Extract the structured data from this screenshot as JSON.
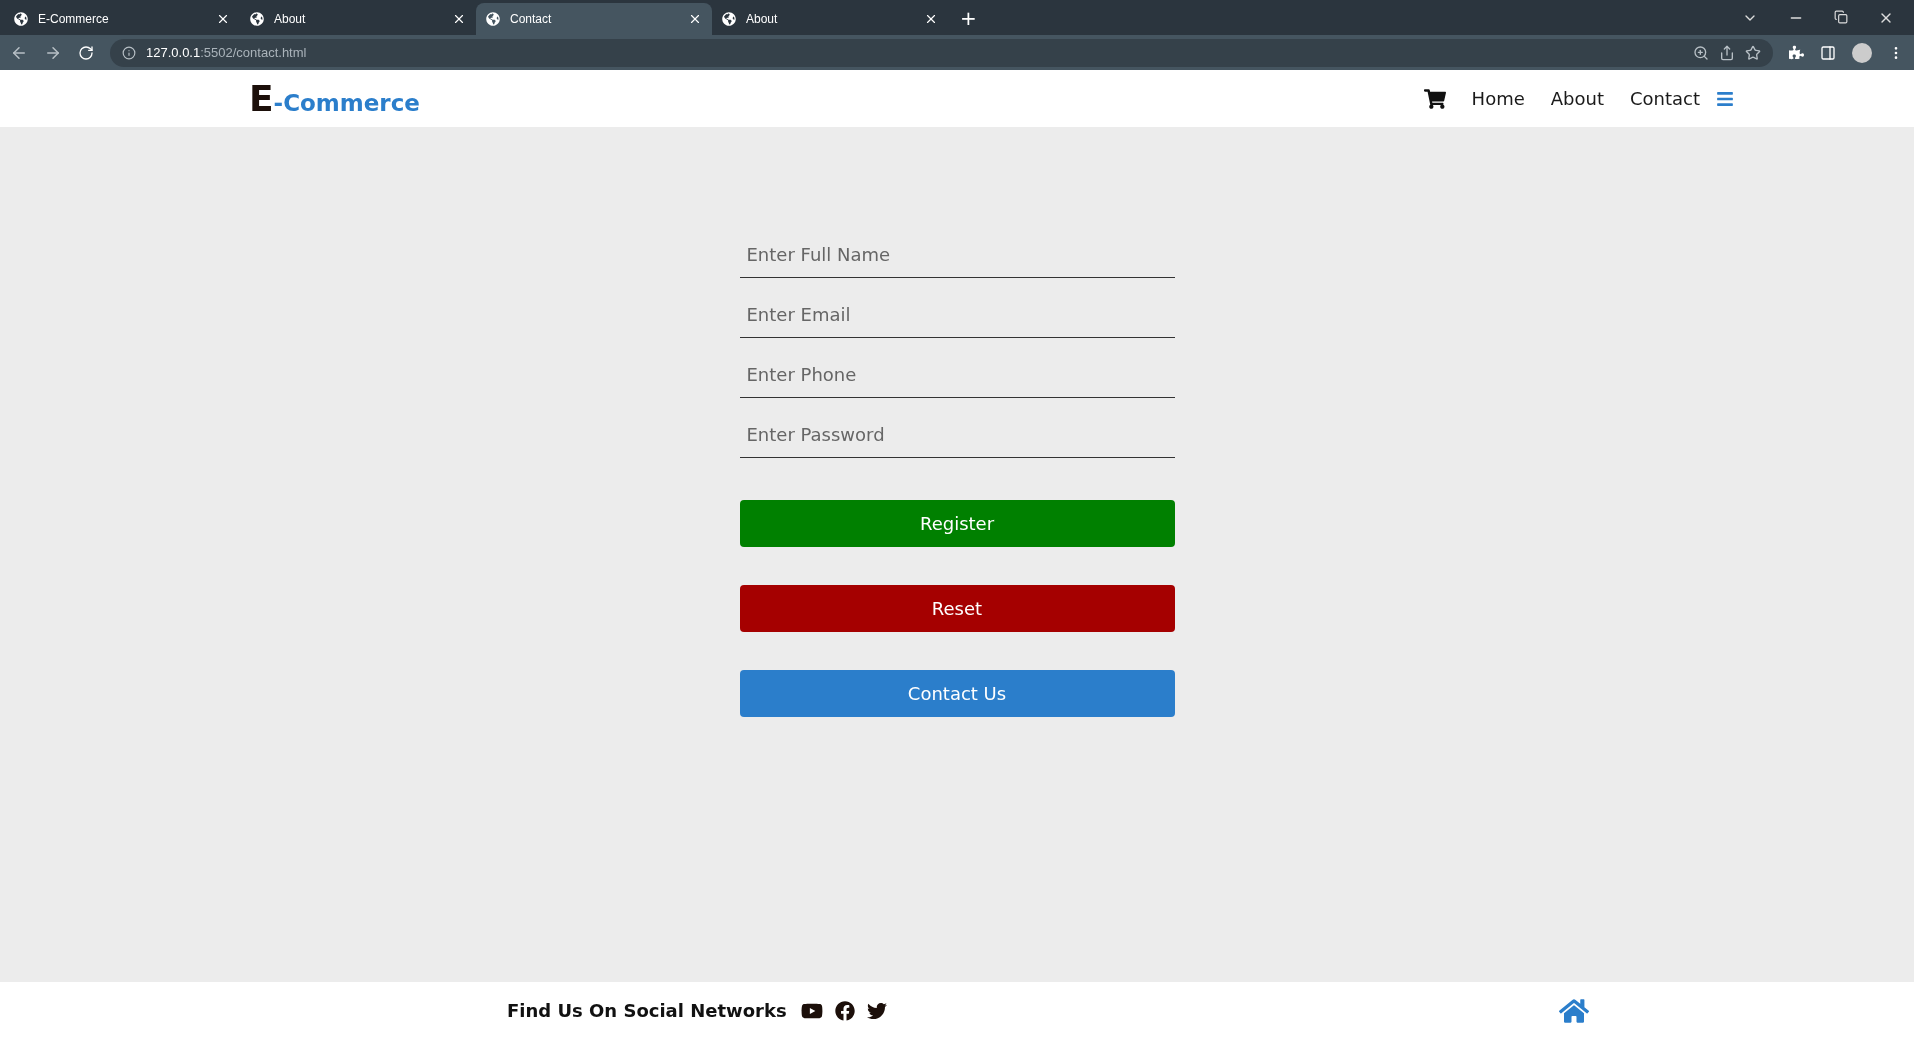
{
  "browser": {
    "tabs": [
      {
        "title": "E-Commerce",
        "selected": false
      },
      {
        "title": "About",
        "selected": false
      },
      {
        "title": "Contact",
        "selected": true
      },
      {
        "title": "About",
        "selected": false
      }
    ],
    "new_tab": "+",
    "url_host": "127.0.0.1",
    "url_rest": ":5502/contact.html"
  },
  "header": {
    "logo_letter": "E",
    "logo_rest": "-Commerce",
    "nav": [
      {
        "label": "Home"
      },
      {
        "label": "About"
      },
      {
        "label": "Contact"
      }
    ]
  },
  "form": {
    "fields": [
      {
        "placeholder": "Enter Full Name"
      },
      {
        "placeholder": "Enter Email"
      },
      {
        "placeholder": "Enter Phone"
      },
      {
        "placeholder": "Enter Password"
      }
    ],
    "buttons": [
      {
        "label": "Register",
        "kind": "register"
      },
      {
        "label": "Reset",
        "kind": "reset"
      },
      {
        "label": "Contact Us",
        "kind": "contact"
      }
    ]
  },
  "footer": {
    "text": "Find Us On Social Networks"
  }
}
